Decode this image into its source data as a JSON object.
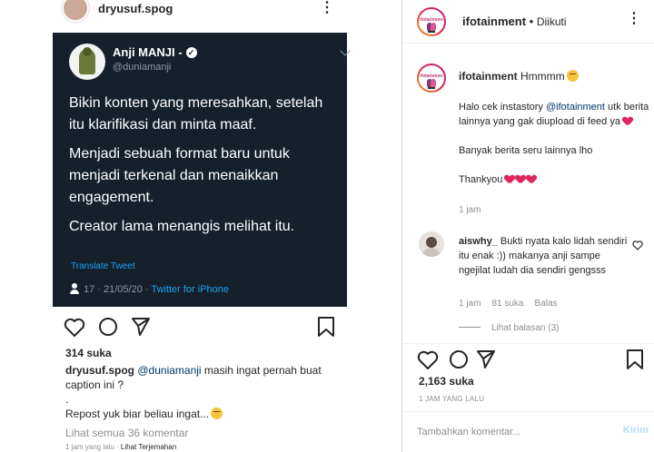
{
  "inner_post": {
    "username": "dryusuf.spog",
    "tweet": {
      "name": "Anji MANJI -",
      "handle": "@duniamanji",
      "paragraphs": [
        "Bikin konten yang meresahkan, setelah itu klarifikasi dan minta maaf.",
        "Menjadi sebuah format baru untuk menjadi terkenal dan menaikkan engagement.",
        "Creator lama menangis melihat itu."
      ],
      "translate": "Translate Tweet",
      "meta": "17 · 21/05/20 · ",
      "client": "Twitter for iPhone"
    },
    "likes": "314 suka",
    "caption_user": "dryusuf.spog",
    "caption_mention": "@duniamanji",
    "caption_text": " masih ingat pernah buat caption ini ?",
    "caption_dot": ".",
    "caption_line2": "Repost yuk biar beliau ingat...",
    "view_all": "Lihat semua 36 komentar",
    "time": "1 jam yang lalu · ",
    "translate_link": "Lihat Terjemahan"
  },
  "panel": {
    "header_user": "ifotainment",
    "header_dot": " • ",
    "header_follow": "Diikuti",
    "logo_text": "ifotainment",
    "caption_user": "ifotainment",
    "caption_text": " Hmmmm",
    "caption_body_1": "Halo cek instastory ",
    "caption_mention": "@ifotainment",
    "caption_body_2": " utk berita lainnya yang gak diupload di feed ya",
    "caption_body_3": "Banyak berita seru lainnya lho",
    "caption_body_4": "Thankyou",
    "caption_time": "1 jam",
    "comment_user": "aiswhy_",
    "comment_text": " Bukti nyata kalo lidah sendiri itu enak :)) makanya anji sampe ngejilat ludah dia sendiri gengsss",
    "comment_time": "1 jam",
    "comment_likes": "81 suka",
    "comment_reply": "Balas",
    "view_replies": "Lihat balasan (3)",
    "likes": "2,163 suka",
    "time": "1 JAM YANG LALU",
    "input_placeholder": "Tambahkan komentar...",
    "send_label": "Kirim"
  },
  "icons": {
    "like": "heart-icon",
    "comment": "comment-icon",
    "share": "send-icon",
    "save": "bookmark-icon",
    "more": "more-icon"
  },
  "colors": {
    "tweet_bg": "#15202b",
    "link": "#1da1f2",
    "mention": "#00376b",
    "heart": "#e0245e"
  }
}
